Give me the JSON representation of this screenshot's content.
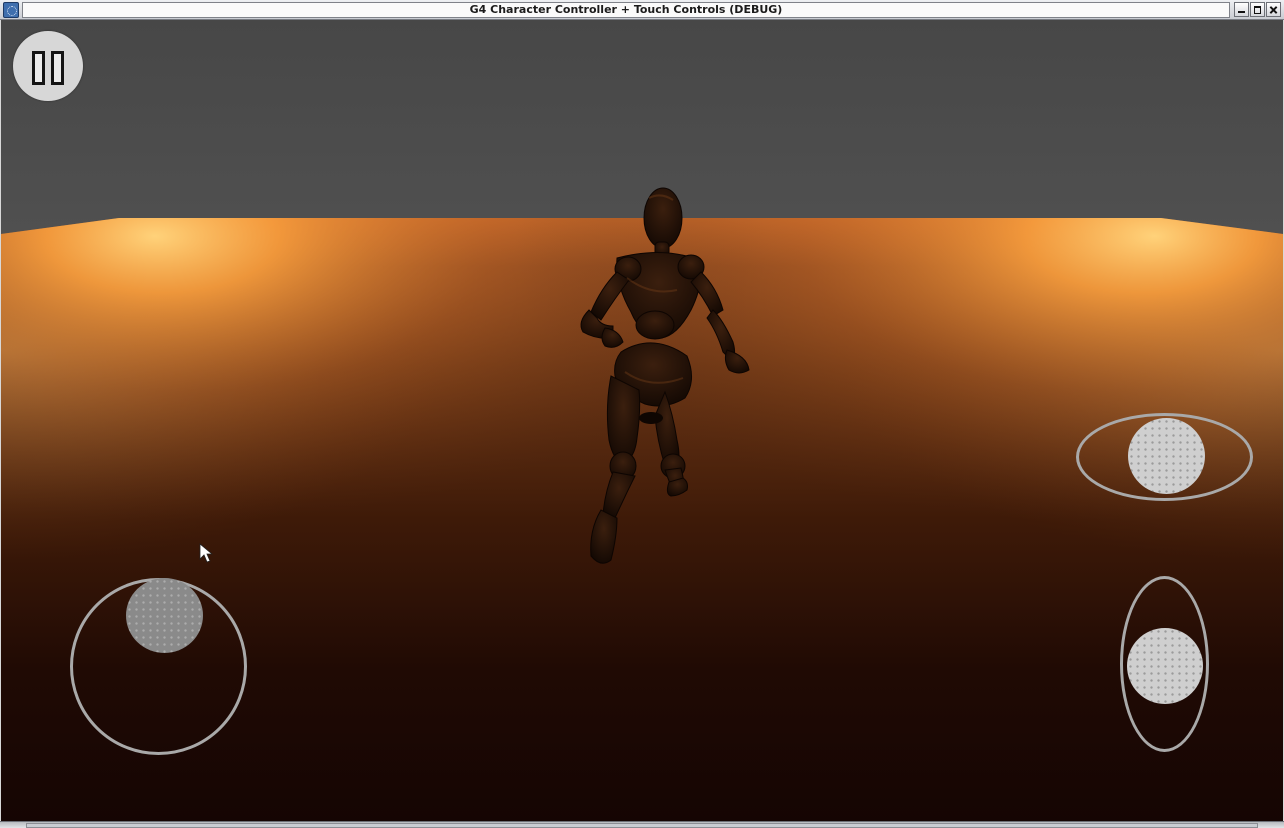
{
  "window": {
    "title": "G4 Character Controller + Touch Controls (DEBUG)",
    "app_icon": "app-gear-icon",
    "controls": {
      "minimize": "minimize-icon",
      "maximize": "maximize-icon",
      "close": "close-icon"
    }
  },
  "scene": {
    "sky_color": "#4c4c4c",
    "floor_glow_color": "#ff9a3c",
    "floor_dark_color": "#170604",
    "character_color": "#2a1509"
  },
  "hud": {
    "pause_button_icon": "pause-icon",
    "move_joystick": {
      "knob_color": "#8a8a8a",
      "ring_color": "#a9a9a9"
    },
    "look_horizontal_slider": {
      "knob_color": "#cfcfcf",
      "ring_color": "#a9a9a9"
    },
    "look_vertical_slider": {
      "knob_color": "#cfcfcf",
      "ring_color": "#a9a9a9"
    }
  }
}
